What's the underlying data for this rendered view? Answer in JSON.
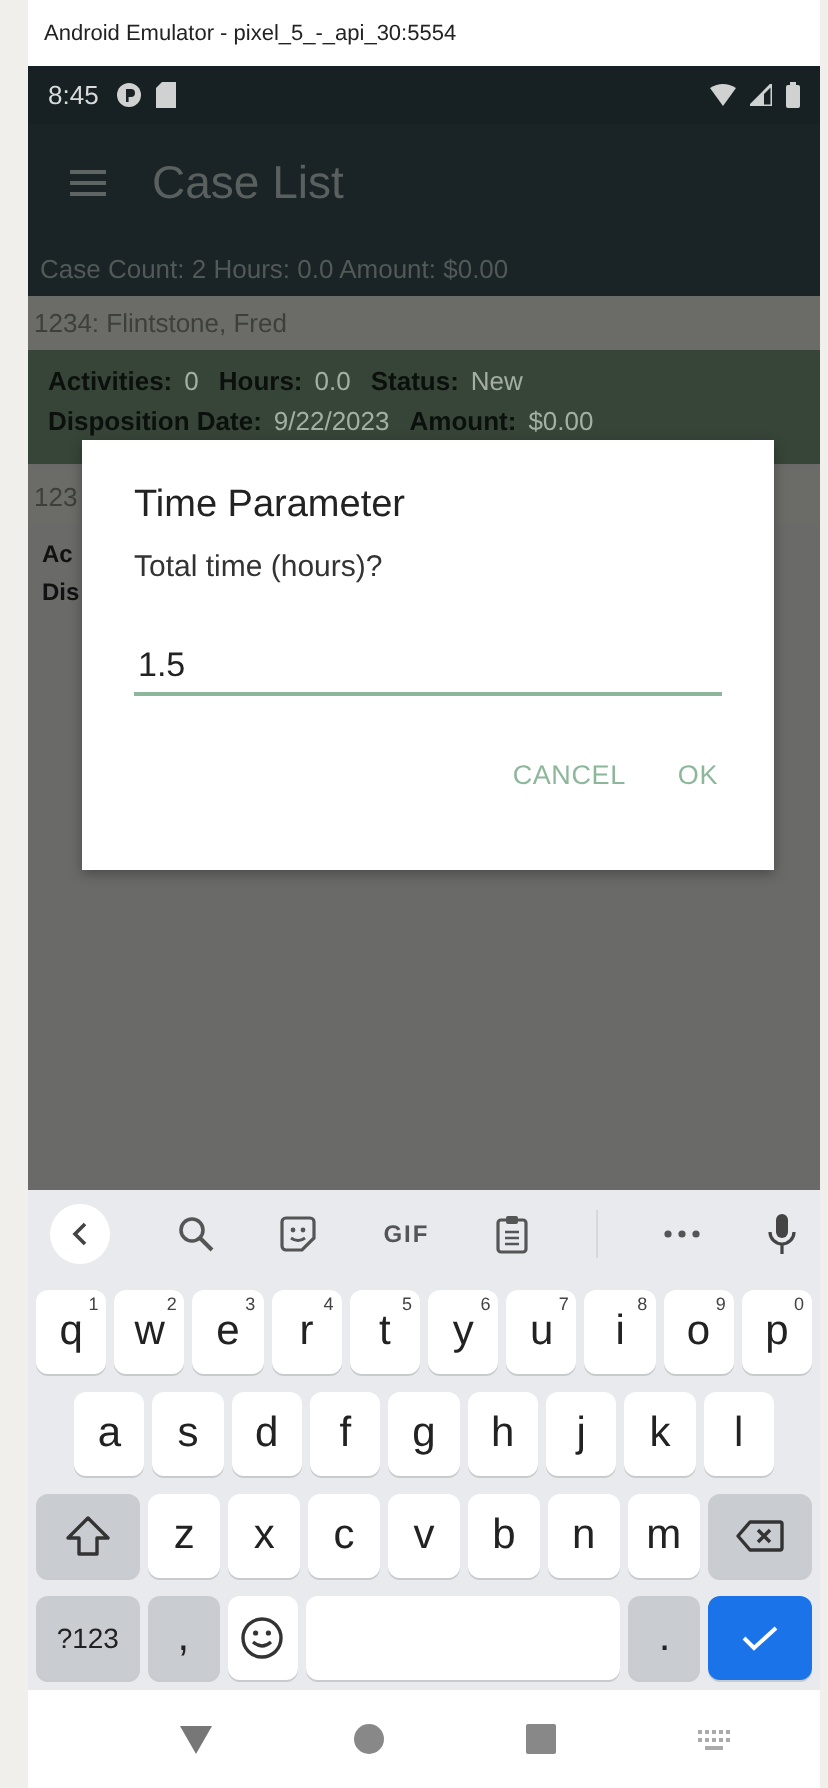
{
  "window": {
    "title": "Android Emulator - pixel_5_-_api_30:5554"
  },
  "status_bar": {
    "time": "8:45"
  },
  "app_bar": {
    "title": "Case List"
  },
  "summary": "Case Count: 2 Hours: 0.0 Amount: $0.00",
  "cases": [
    {
      "header": "1234: Flintstone, Fred",
      "lines": [
        [
          {
            "label": "Activities:",
            "value": "0"
          },
          {
            "label": "Hours:",
            "value": "0.0"
          },
          {
            "label": "Status:",
            "value": "New"
          }
        ],
        [
          {
            "label": "Disposition Date:",
            "value": "9/22/2023"
          },
          {
            "label": "Amount:",
            "value": "$0.00"
          }
        ]
      ]
    },
    {
      "header": "123",
      "lines": [
        [
          {
            "label": "Ac"
          }
        ],
        [
          {
            "label": "Dis"
          }
        ]
      ]
    }
  ],
  "dialog": {
    "title": "Time Parameter",
    "message": "Total time (hours)?",
    "input": {
      "value": "1.5"
    },
    "buttons": [
      "CANCEL",
      "OK"
    ]
  },
  "keyboard": {
    "toolbar": [
      {
        "kind": "back"
      },
      {
        "kind": "search"
      },
      {
        "kind": "sticker"
      },
      {
        "kind": "text",
        "label": "GIF"
      },
      {
        "kind": "clipboard"
      },
      {
        "kind": "divider"
      },
      {
        "kind": "more"
      },
      {
        "kind": "mic"
      }
    ],
    "key_rows": [
      {
        "keys": [
          {
            "kind": "char",
            "label": "q",
            "hint": "1"
          },
          {
            "kind": "char",
            "label": "w",
            "hint": "2"
          },
          {
            "kind": "char",
            "label": "e",
            "hint": "3"
          },
          {
            "kind": "char",
            "label": "r",
            "hint": "4"
          },
          {
            "kind": "char",
            "label": "t",
            "hint": "5"
          },
          {
            "kind": "char",
            "label": "y",
            "hint": "6"
          },
          {
            "kind": "char",
            "label": "u",
            "hint": "7"
          },
          {
            "kind": "char",
            "label": "i",
            "hint": "8"
          },
          {
            "kind": "char",
            "label": "o",
            "hint": "9"
          },
          {
            "kind": "char",
            "label": "p",
            "hint": "0"
          }
        ]
      },
      {
        "keys": [
          {
            "kind": "char",
            "label": "a"
          },
          {
            "kind": "char",
            "label": "s"
          },
          {
            "kind": "char",
            "label": "d"
          },
          {
            "kind": "char",
            "label": "f"
          },
          {
            "kind": "char",
            "label": "g"
          },
          {
            "kind": "char",
            "label": "h"
          },
          {
            "kind": "char",
            "label": "j"
          },
          {
            "kind": "char",
            "label": "k"
          },
          {
            "kind": "char",
            "label": "l"
          }
        ]
      },
      {
        "keys": [
          {
            "kind": "shift"
          },
          {
            "kind": "char",
            "label": "z"
          },
          {
            "kind": "char",
            "label": "x"
          },
          {
            "kind": "char",
            "label": "c"
          },
          {
            "kind": "char",
            "label": "v"
          },
          {
            "kind": "char",
            "label": "b"
          },
          {
            "kind": "char",
            "label": "n"
          },
          {
            "kind": "char",
            "label": "m"
          },
          {
            "kind": "backspace"
          }
        ]
      },
      {
        "keys": [
          {
            "kind": "symbols",
            "label": "?123"
          },
          {
            "kind": "punct",
            "label": ","
          },
          {
            "kind": "emoji"
          },
          {
            "kind": "space"
          },
          {
            "kind": "punct",
            "label": "."
          },
          {
            "kind": "enter"
          }
        ]
      }
    ]
  }
}
